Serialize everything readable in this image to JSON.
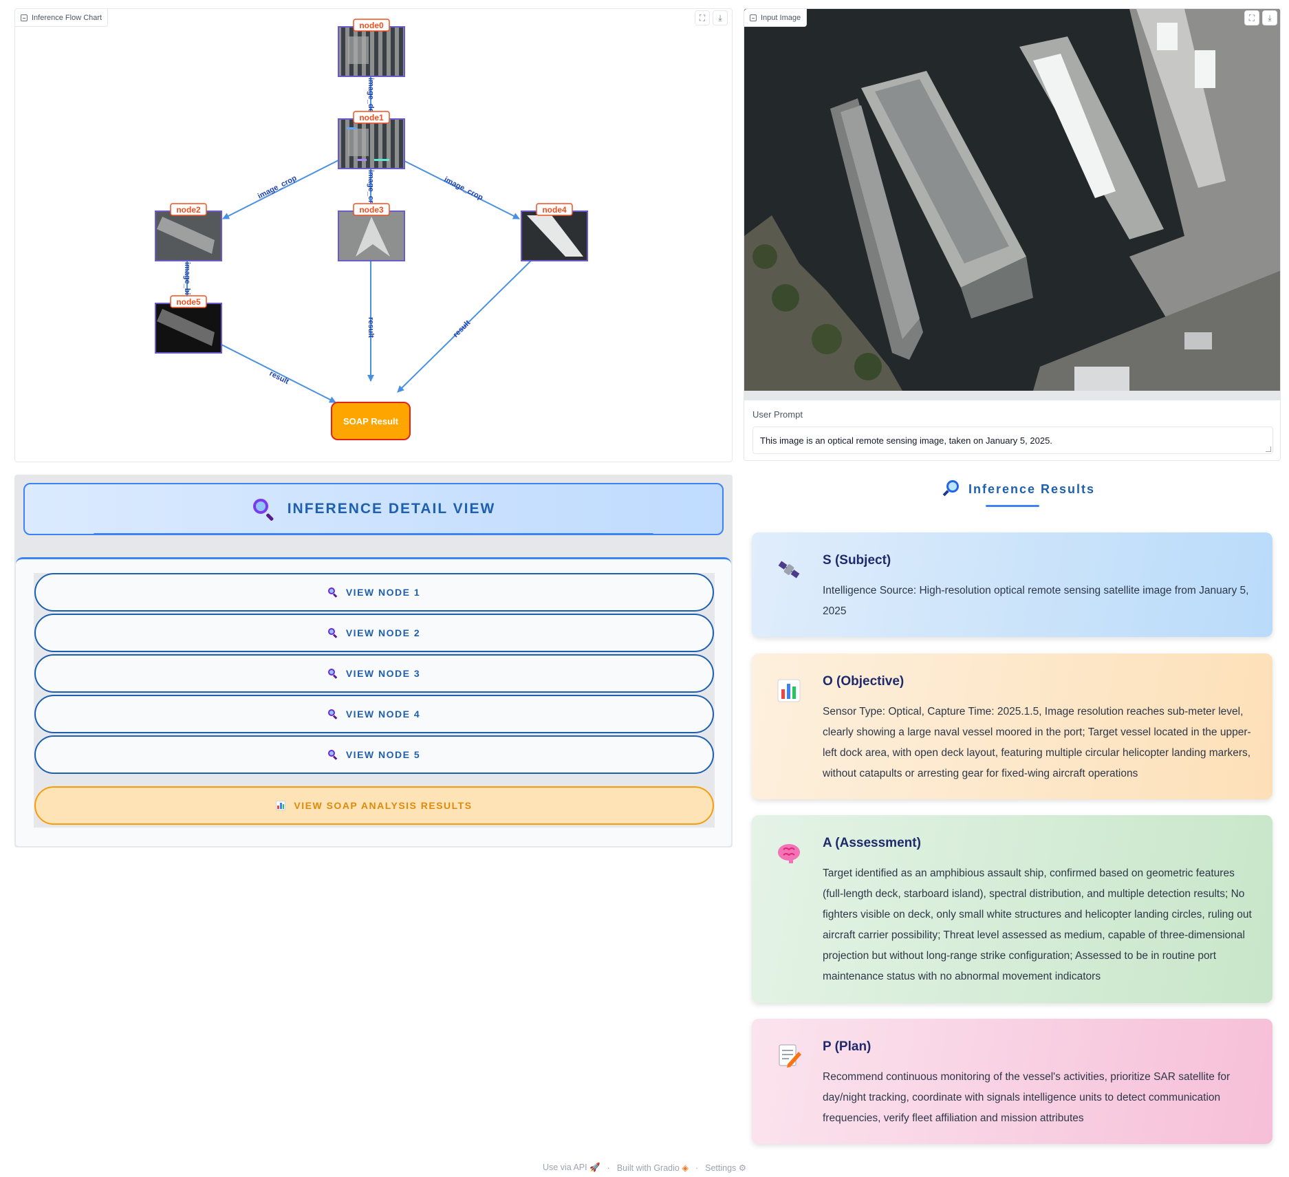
{
  "flow_panel": {
    "label": "Inference Flow Chart",
    "nodes": [
      "node0",
      "node1",
      "node2",
      "node3",
      "node4",
      "node5"
    ],
    "edges": {
      "e01": "image_detection",
      "e12": "image_crop",
      "e13": "image_crop",
      "e14": "image_crop",
      "e25": "image_binarization",
      "e5r": "result",
      "e3r": "result",
      "e4r": "result"
    },
    "result_node": "SOAP Result",
    "colors": {
      "node_label": "#f24e1e",
      "edge": "#4a90e2",
      "result": "#ffa500"
    },
    "icons": {
      "fullscreen": "fullscreen-icon",
      "download": "download-icon"
    }
  },
  "image_panel": {
    "label": "Input Image",
    "prompt_label": "User Prompt",
    "prompt_value": "This image is an optical remote sensing image, taken on January 5, 2025."
  },
  "detail_view": {
    "title": "INFERENCE DETAIL VIEW",
    "buttons": [
      "VIEW NODE 1",
      "VIEW NODE 2",
      "VIEW NODE 3",
      "VIEW NODE 4",
      "VIEW NODE 5"
    ],
    "soap_button": "VIEW SOAP ANALYSIS RESULTS"
  },
  "results": {
    "title": "Inference Results",
    "cards": [
      {
        "title": "S (Subject)",
        "icon": "satellite-icon",
        "text": "Intelligence Source: High-resolution optical remote sensing satellite image from January 5, 2025"
      },
      {
        "title": "O (Objective)",
        "icon": "bar-chart-icon",
        "text": "Sensor Type: Optical, Capture Time: 2025.1.5, Image resolution reaches sub-meter level, clearly showing a large naval vessel moored in the port; Target vessel located in the upper-left dock area, with open deck layout, featuring multiple circular helicopter landing markers, without catapults or arresting gear for fixed-wing aircraft operations"
      },
      {
        "title": "A (Assessment)",
        "icon": "brain-icon",
        "text": "Target identified as an amphibious assault ship, confirmed based on geometric features (full-length deck, starboard island), spectral distribution, and multiple detection results; No fighters visible on deck, only small white structures and helicopter landing circles, ruling out aircraft carrier possibility; Threat level assessed as medium, capable of three-dimensional projection but without long-range strike configuration; Assessed to be in routine port maintenance status with no abnormal movement indicators"
      },
      {
        "title": "P (Plan)",
        "icon": "memo-icon",
        "text": "Recommend continuous monitoring of the vessel's activities, prioritize SAR satellite for day/night tracking, coordinate with signals intelligence units to detect communication frequencies, verify fleet affiliation and mission attributes"
      }
    ]
  },
  "footer": {
    "api": "Use via API",
    "built": "Built with Gradio",
    "settings": "Settings"
  }
}
